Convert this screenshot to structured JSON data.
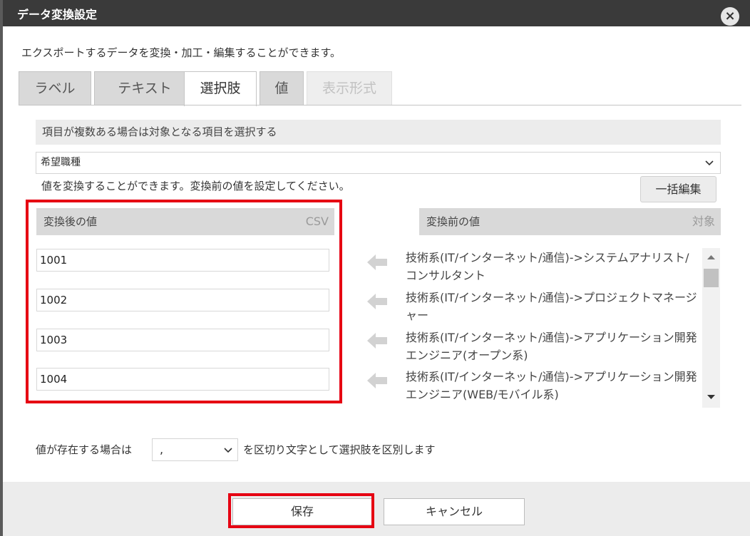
{
  "dialog": {
    "title": "データ変換設定",
    "close_symbol": "×",
    "description": "エクスポートするデータを変換・加工・編集することができます。"
  },
  "tabs": [
    {
      "label": "ラベル",
      "state": "normal"
    },
    {
      "label": "テキスト",
      "state": "normal"
    },
    {
      "label": "選択肢",
      "state": "active"
    },
    {
      "label": "値",
      "state": "normal"
    },
    {
      "label": "表示形式",
      "state": "disabled"
    }
  ],
  "scope": {
    "header": "項目が複数ある場合は対象となる項目を選択する",
    "selected": "希望職種"
  },
  "conversion": {
    "hint": "値を変換することができます。変換前の値を設定してください。",
    "bulk_edit_label": "一括編集",
    "after_header": "変換後の値",
    "after_header_right": "CSV",
    "before_header": "変換前の値",
    "before_header_right": "対象",
    "rows": [
      {
        "after": "1001",
        "before": "技術系(IT/インターネット/通信)->システムアナリスト/コンサルタント"
      },
      {
        "after": "1002",
        "before": "技術系(IT/インターネット/通信)->プロジェクトマネージャー"
      },
      {
        "after": "1003",
        "before": "技術系(IT/インターネット/通信)->アプリケーション開発エンジニア(オープン系)"
      },
      {
        "after": "1004",
        "before": "技術系(IT/インターネット/通信)->アプリケーション開発エンジニア(WEB/モバイル系)"
      }
    ]
  },
  "separator": {
    "prefix": "値が存在する場合は",
    "value": ",",
    "suffix": "を区切り文字として選択肢を区別します"
  },
  "footer": {
    "save_label": "保存",
    "cancel_label": "キャンセル"
  },
  "colors": {
    "highlight": "#e60012",
    "titlebar": "#3a3a3a"
  }
}
